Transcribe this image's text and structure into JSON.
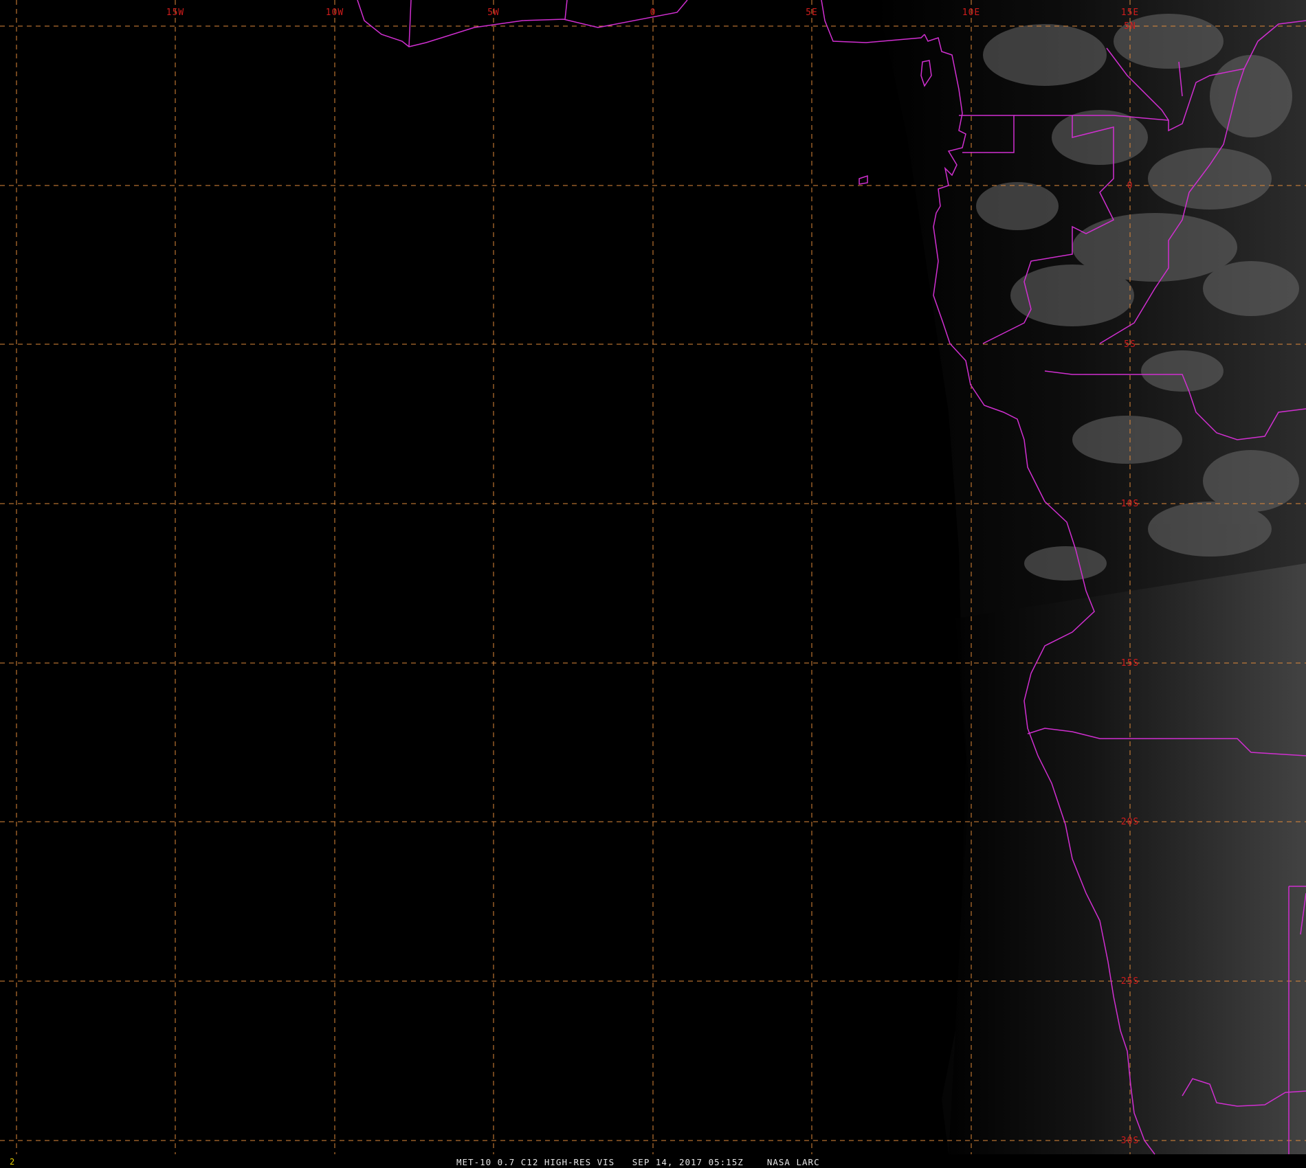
{
  "map": {
    "longitude_labels": [
      "15W",
      "10W",
      "5W",
      "0",
      "5E",
      "10E",
      "15E"
    ],
    "latitude_labels": [
      "5N",
      "0",
      "5S",
      "10S",
      "15S",
      "20S",
      "25S",
      "30S"
    ],
    "grid_color": "#e08a3a",
    "label_color": "#d01c1c",
    "boundary_color": "#d12fd1",
    "grid_style": "dashed"
  },
  "footer": {
    "frame_index": "2",
    "caption": "MET-10 0.7 C12 HIGH-RES VIS   SEP 14, 2017 05:15Z    NASA LARC",
    "caption_color": "#e6e6e6"
  }
}
